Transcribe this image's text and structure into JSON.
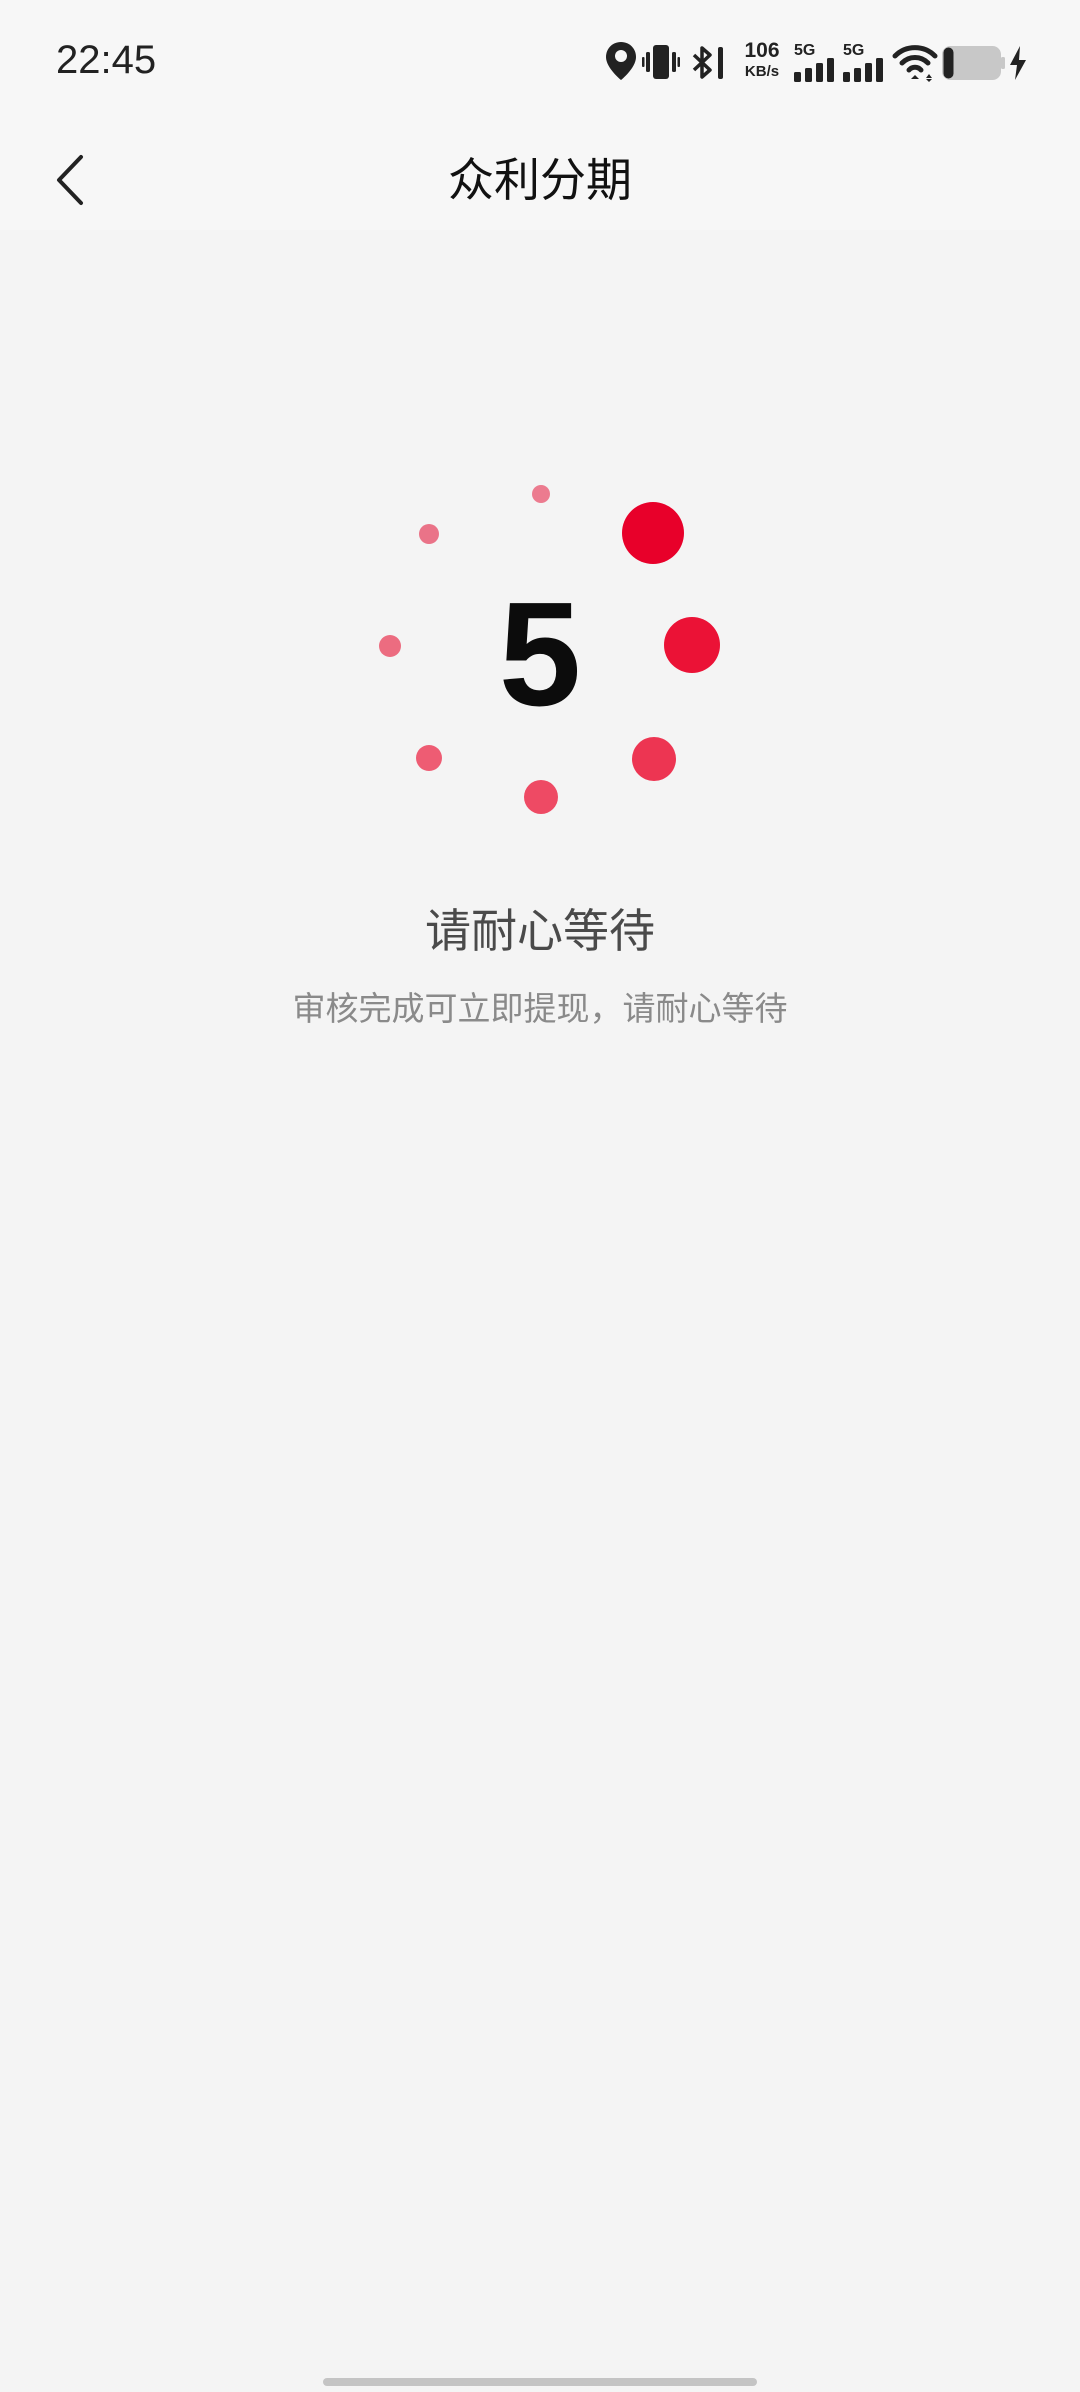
{
  "status_bar": {
    "time": "22:45",
    "net_speed_value": "106",
    "net_speed_unit": "KB/s",
    "sim1_label": "5G",
    "sim2_label": "5G",
    "icons": [
      "location-icon",
      "vibrate-icon",
      "bluetooth-icon",
      "signal-icon",
      "signal-icon",
      "wifi-icon",
      "battery-icon",
      "charging-icon"
    ]
  },
  "nav": {
    "title": "众利分期",
    "back_icon": "chevron-left-icon"
  },
  "loading": {
    "countdown": "5",
    "accent_color": "#e8002a"
  },
  "message": {
    "title": "请耐心等待",
    "subtitle": "审核完成可立即提现，请耐心等待"
  }
}
